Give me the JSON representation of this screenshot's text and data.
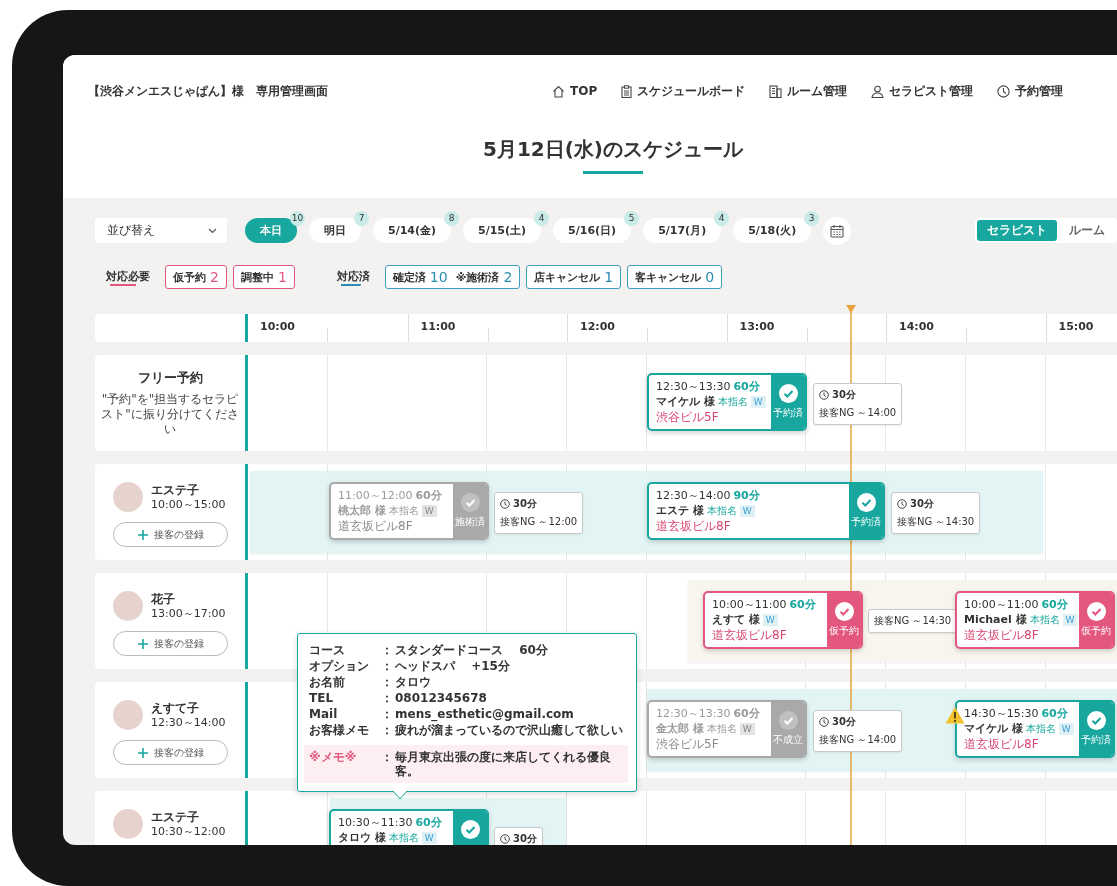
{
  "header": {
    "shop_title": "【渋谷メンエスじゃぱん】様　専用管理画面",
    "nav": [
      {
        "label": "TOP"
      },
      {
        "label": "スケジュールボード"
      },
      {
        "label": "ルーム管理"
      },
      {
        "label": "セラピスト管理"
      },
      {
        "label": "予約管理"
      }
    ]
  },
  "page_title": "5月12日(水)のスケジュール",
  "sort": {
    "value": "並び替え"
  },
  "dates": [
    {
      "label": "本日",
      "count": "10",
      "selected": true
    },
    {
      "label": "明日",
      "count": "7",
      "selected": false
    },
    {
      "label": "5/14(金)",
      "count": "8",
      "selected": false
    },
    {
      "label": "5/15(土)",
      "count": "4",
      "selected": false
    },
    {
      "label": "5/16(日)",
      "count": "5",
      "selected": false
    },
    {
      "label": "5/17(月)",
      "count": "4",
      "selected": false
    },
    {
      "label": "5/18(火)",
      "count": "3",
      "selected": false
    }
  ],
  "view_toggle": [
    {
      "label": "セラピスト",
      "selected": true
    },
    {
      "label": "ルーム",
      "selected": false
    }
  ],
  "needs_action": {
    "label": "対応必要",
    "items": [
      {
        "label": "仮予約",
        "count": "2"
      },
      {
        "label": "調整中",
        "count": "1"
      }
    ]
  },
  "handled": {
    "label": "対応済",
    "items": [
      {
        "label": "確定済",
        "count": "10",
        "extra_label": "※施術済",
        "extra_count": "2"
      },
      {
        "label": "店キャンセル",
        "count": "1"
      },
      {
        "label": "客キャンセル",
        "count": "0"
      }
    ]
  },
  "timeline": {
    "hours": [
      "10:00",
      "11:00",
      "12:00",
      "13:00",
      "14:00",
      "15:00"
    ]
  },
  "rows": [
    {
      "kind": "free",
      "title": "フリー予約",
      "hint": "\"予約\"を\"担当するセラピスト\"に振り分けてください",
      "bookings": [
        {
          "time": "12:30～13:30",
          "duration": "60分",
          "customer": "マイケル 様",
          "nomination": "本指名",
          "badge": "W",
          "place": "渋谷ビル5F",
          "kind": "reserved",
          "status_label": "予約済",
          "warning": false,
          "note": {
            "interval": "30分",
            "ng": "接客NG ～14:00"
          }
        }
      ]
    },
    {
      "kind": "therapist",
      "name": "エステ子",
      "hours": "10:00～15:00",
      "button": "接客の登録",
      "bookings": [
        {
          "time": "11:00～12:00",
          "duration": "60分",
          "customer": "桃太郎 様",
          "nomination": "本指名",
          "badge": "W",
          "place": "道玄坂ビル8F",
          "kind": "done",
          "status_label": "施術済",
          "warning": false,
          "note": {
            "interval": "30分",
            "ng": "接客NG ～12:00"
          }
        },
        {
          "time": "12:30～14:00",
          "duration": "90分",
          "customer": "エステ 様",
          "nomination": "本指名",
          "badge": "W",
          "place": "道玄坂ビル8F",
          "kind": "reserved",
          "status_label": "予約済",
          "warning": false,
          "note": {
            "interval": "30分",
            "ng": "接客NG ～14:30"
          }
        }
      ]
    },
    {
      "kind": "therapist",
      "name": "花子",
      "hours": "13:00～17:00",
      "button": "接客の登録",
      "bookings": [
        {
          "time": "10:00～11:00",
          "duration": "60分",
          "customer": "えすて 様",
          "badge": "W",
          "place": "道玄坂ビル8F",
          "kind": "tentative",
          "status_label": "仮予約",
          "warning": false,
          "note": {
            "ng": "接客NG ～14:30"
          }
        },
        {
          "time": "10:00～11:00",
          "duration": "60分",
          "customer": "Michael 様",
          "nomination": "本指名",
          "badge": "W",
          "place": "道玄坂ビル8F",
          "kind": "tentative",
          "status_label": "仮予約",
          "warning": false
        }
      ]
    },
    {
      "kind": "therapist",
      "name": "えすて子",
      "hours": "12:30～14:00",
      "button": "接客の登録",
      "bookings": [
        {
          "time": "12:30～13:30",
          "duration": "60分",
          "customer": "金太郎 様",
          "nomination": "本指名",
          "badge": "W",
          "place": "渋谷ビル5F",
          "kind": "failed",
          "status_label": "不成立",
          "warning": false,
          "note": {
            "interval": "30分",
            "ng": "接客NG ～14:00"
          }
        },
        {
          "time": "14:30～15:30",
          "duration": "60分",
          "customer": "マイケル 様",
          "nomination": "本指名",
          "badge": "W",
          "place": "道玄坂ビル8F",
          "kind": "reserved",
          "status_label": "予約済",
          "warning": true
        }
      ]
    },
    {
      "kind": "therapist",
      "name": "エステ子",
      "hours": "10:30～12:00",
      "bookings": [
        {
          "time": "10:30～11:30",
          "duration": "60分",
          "customer": "タロウ 様",
          "nomination": "本指名",
          "badge": "W",
          "kind": "reserved",
          "warning": false,
          "note": {
            "interval": "30分"
          }
        }
      ]
    }
  ],
  "detail_popover": {
    "rows": [
      {
        "label": "コース",
        "sep": "：",
        "value": "スタンダードコース　 60分"
      },
      {
        "label": "オプション",
        "sep": "：",
        "value": "ヘッドスパ　 +15分"
      },
      {
        "label": "お名前",
        "sep": "：",
        "value": "タロウ"
      },
      {
        "label": "TEL",
        "sep": "：",
        "value": "08012345678"
      },
      {
        "label": "Mail",
        "sep": "：",
        "value": "mens_esthetic@gmail.com"
      },
      {
        "label": "お客様メモ",
        "sep": "：",
        "value": "疲れが溜まっているので沢山癒して欲しい"
      }
    ],
    "memo": {
      "label": "※メモ※",
      "sep": "：",
      "value": "毎月東京出張の度に来店してくれる優良客。"
    }
  }
}
